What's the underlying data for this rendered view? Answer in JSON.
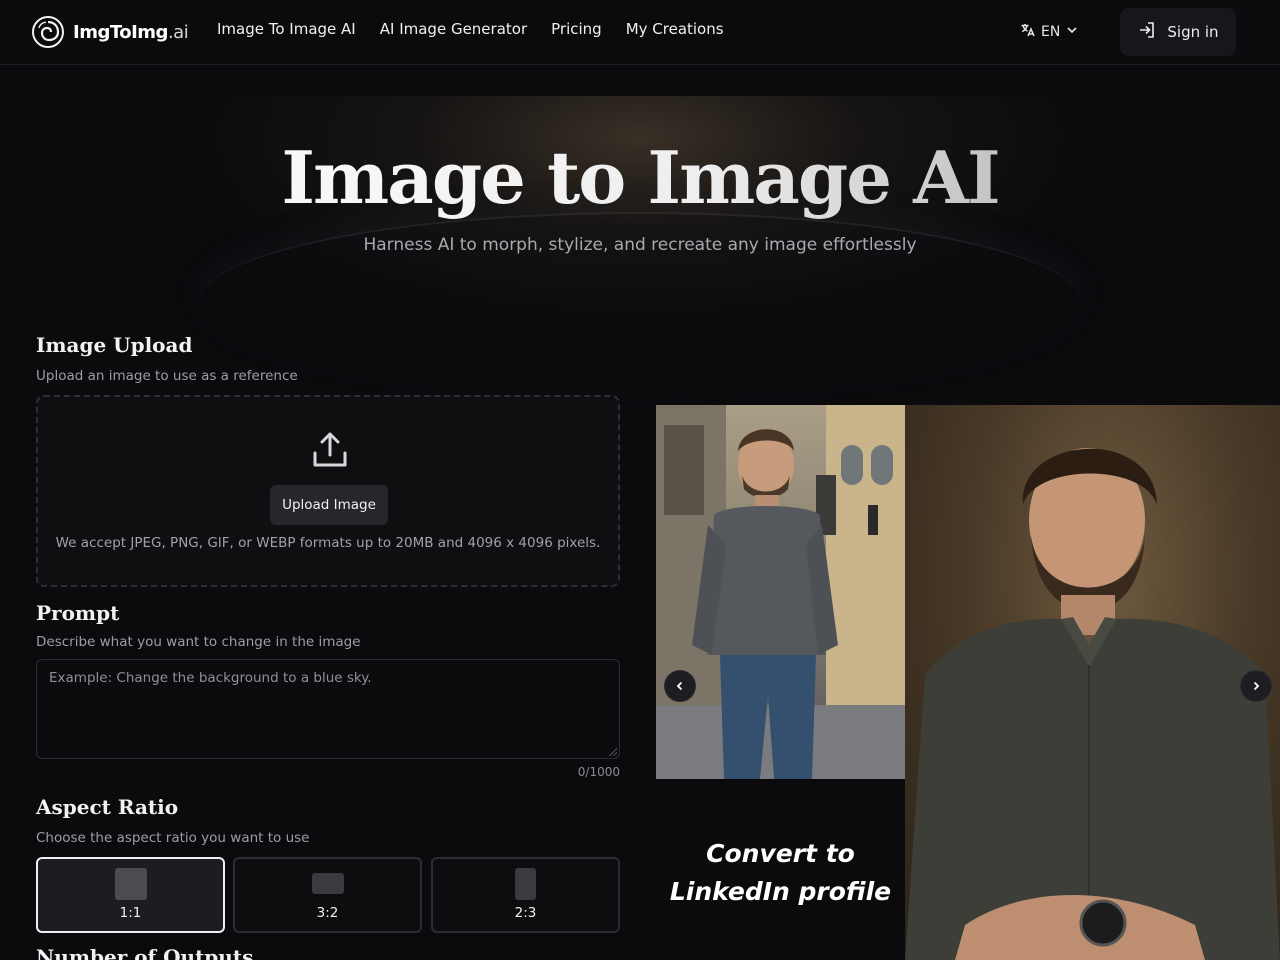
{
  "header": {
    "logo_text": "ImgToImg",
    "logo_suffix": ".ai",
    "nav": [
      {
        "label": "Image To Image AI"
      },
      {
        "label": "AI Image Generator"
      },
      {
        "label": "Pricing"
      },
      {
        "label": "My Creations"
      }
    ],
    "language": "EN",
    "signin_label": "Sign in"
  },
  "hero": {
    "title": "Image to Image AI",
    "subtitle": "Harness AI to morph, stylize, and recreate any image effortlessly"
  },
  "upload": {
    "title": "Image Upload",
    "description": "Upload an image to use as a reference",
    "button_label": "Upload Image",
    "note": "We accept JPEG, PNG, GIF, or WEBP formats up to 20MB and 4096 x 4096 pixels."
  },
  "prompt": {
    "title": "Prompt",
    "description": "Describe what you want to change in the image",
    "placeholder": "Example: Change the background to a blue sky.",
    "value": "",
    "counter": "0/1000"
  },
  "aspect_ratio": {
    "title": "Aspect Ratio",
    "description": "Choose the aspect ratio you want to use",
    "options": [
      {
        "label": "1:1",
        "selected": true
      },
      {
        "label": "3:2",
        "selected": false
      },
      {
        "label": "2:3",
        "selected": false
      }
    ]
  },
  "outputs": {
    "title": "Number of Outputs"
  },
  "showcase": {
    "caption_line1": "Convert to",
    "caption_line2": "LinkedIn profile",
    "prev_icon": "chevron-left-icon",
    "next_icon": "chevron-right-icon"
  },
  "colors": {
    "background": "#0b0b0e",
    "panel": "#17171b",
    "accent_text": "#f2f2f4",
    "muted_text": "#9d9da5"
  }
}
